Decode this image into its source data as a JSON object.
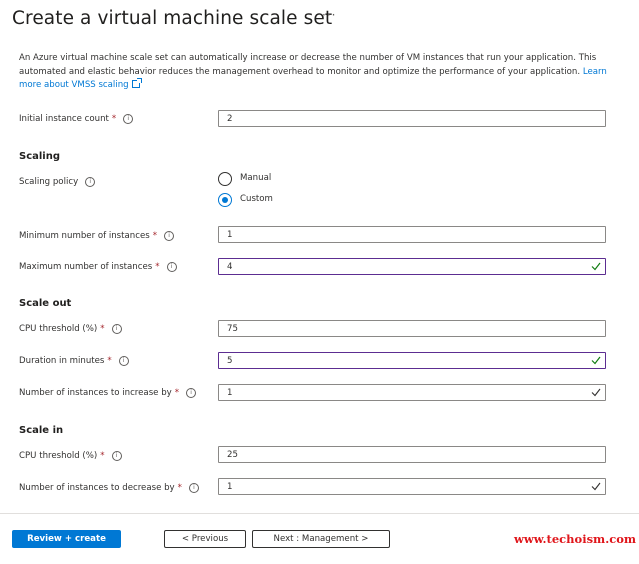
{
  "header": {
    "title": "Create a virtual machine scale set",
    "more_icon": "ellipsis-icon",
    "more_label": "···"
  },
  "description": {
    "text": "An Azure virtual machine scale set can automatically increase or decrease the number of VM instances that run your application. This automated and elastic behavior reduces the management overhead to monitor and optimize the performance of your application.",
    "link_label": "Learn more about VMSS scaling"
  },
  "initial_count": {
    "label": "Initial instance count",
    "required": "*",
    "value": "2"
  },
  "scaling": {
    "heading": "Scaling",
    "policy_label": "Scaling policy",
    "options": [
      {
        "label": "Manual",
        "selected": false
      },
      {
        "label": "Custom",
        "selected": true
      }
    ],
    "min": {
      "label": "Minimum number of instances",
      "required": "*",
      "value": "1"
    },
    "max": {
      "label": "Maximum number of instances",
      "required": "*",
      "value": "4"
    }
  },
  "scale_out": {
    "heading": "Scale out",
    "cpu": {
      "label": "CPU threshold (%)",
      "required": "*",
      "value": "75"
    },
    "duration": {
      "label": "Duration in minutes",
      "required": "*",
      "value": "5"
    },
    "increase": {
      "label": "Number of instances to increase by",
      "required": "*",
      "value": "1"
    }
  },
  "scale_in": {
    "heading": "Scale in",
    "cpu": {
      "label": "CPU threshold (%)",
      "required": "*",
      "value": "25"
    },
    "decrease": {
      "label": "Number of instances to decrease by",
      "required": "*",
      "value": "1"
    }
  },
  "footer": {
    "review_label": "Review + create",
    "previous_label": "< Previous",
    "next_label": "Next : Management >"
  },
  "watermark": "www.techoism.com",
  "colors": {
    "accent": "#0078d4",
    "required": "#a4262c",
    "valid_border": "#5c2d91",
    "watermark": "#e0161b"
  },
  "icons": {
    "info": "info-icon",
    "check": "checkmark-icon",
    "external": "external-link-icon"
  }
}
